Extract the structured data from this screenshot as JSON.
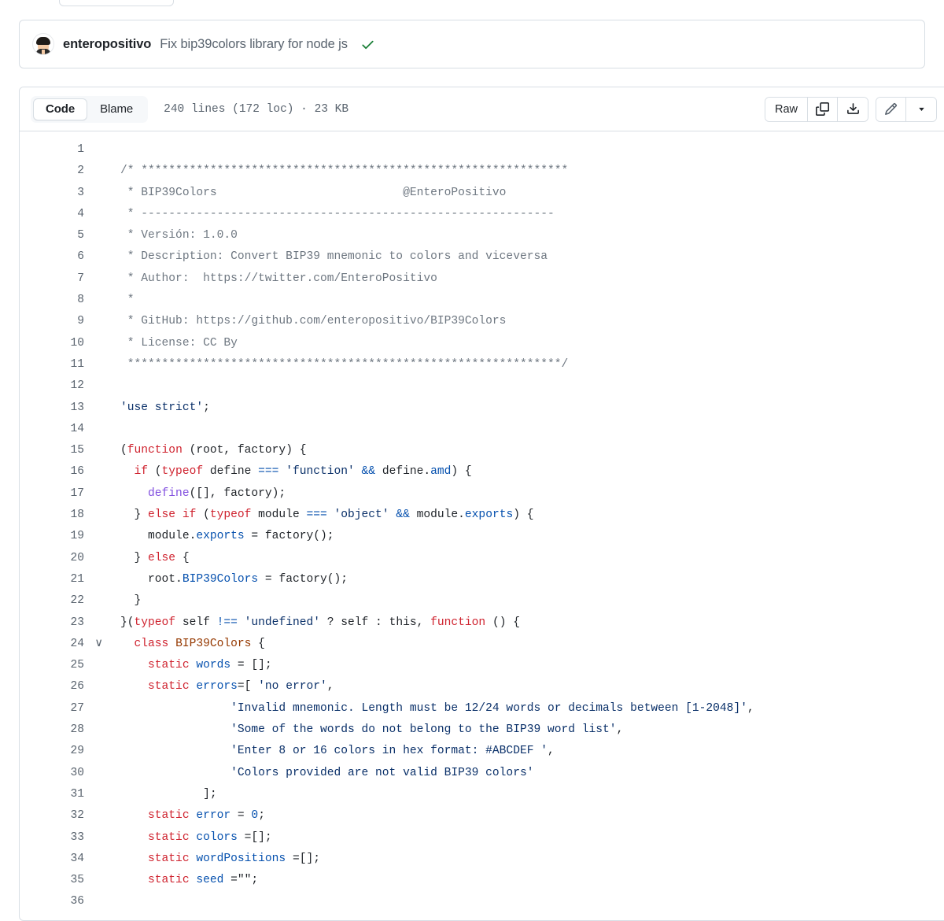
{
  "commit": {
    "author": "enteropositivo",
    "message": "Fix bip39colors library for node js",
    "status_icon": "check-icon",
    "status_color": "#1a7f37"
  },
  "file_header": {
    "tabs": [
      {
        "label": "Code",
        "active": true
      },
      {
        "label": "Blame",
        "active": false
      }
    ],
    "meta": "240 lines (172 loc) · 23 KB",
    "lines_count": "240",
    "loc_count": "172",
    "file_size": "23 KB",
    "actions": {
      "raw_label": "Raw",
      "copy_icon": "copy-icon",
      "download_icon": "download-icon",
      "edit_icon": "pencil-icon",
      "more_icon": "chevron-down-icon"
    }
  },
  "code": {
    "first_line": 1,
    "collapsible_lines": [
      24
    ],
    "lines": [
      {
        "n": 1,
        "tokens": []
      },
      {
        "n": 2,
        "tokens": [
          {
            "t": "c",
            "v": "/* **************************************************************"
          }
        ]
      },
      {
        "n": 3,
        "tokens": [
          {
            "t": "c",
            "v": " * BIP39Colors                           @EnteroPositivo"
          }
        ]
      },
      {
        "n": 4,
        "tokens": [
          {
            "t": "c",
            "v": " * ------------------------------------------------------------"
          }
        ]
      },
      {
        "n": 5,
        "tokens": [
          {
            "t": "c",
            "v": " * Versión: 1.0.0"
          }
        ]
      },
      {
        "n": 6,
        "tokens": [
          {
            "t": "c",
            "v": " * Description: Convert BIP39 mnemonic to colors and viceversa"
          }
        ]
      },
      {
        "n": 7,
        "tokens": [
          {
            "t": "c",
            "v": " * Author:  https://twitter.com/EnteroPositivo"
          }
        ]
      },
      {
        "n": 8,
        "tokens": [
          {
            "t": "c",
            "v": " *"
          }
        ]
      },
      {
        "n": 9,
        "tokens": [
          {
            "t": "c",
            "v": " * GitHub: https://github.com/enteropositivo/BIP39Colors"
          }
        ]
      },
      {
        "n": 10,
        "tokens": [
          {
            "t": "c",
            "v": " * License: CC By"
          }
        ]
      },
      {
        "n": 11,
        "tokens": [
          {
            "t": "c",
            "v": " ***************************************************************/"
          }
        ]
      },
      {
        "n": 12,
        "tokens": []
      },
      {
        "n": 13,
        "tokens": [
          {
            "t": "s",
            "v": "'use strict'"
          },
          {
            "t": "x",
            "v": ";"
          }
        ]
      },
      {
        "n": 14,
        "tokens": []
      },
      {
        "n": 15,
        "tokens": [
          {
            "t": "x",
            "v": "("
          },
          {
            "t": "k",
            "v": "function"
          },
          {
            "t": "x",
            "v": " (root, factory) {"
          }
        ]
      },
      {
        "n": 16,
        "tokens": [
          {
            "t": "x",
            "v": "  "
          },
          {
            "t": "k",
            "v": "if"
          },
          {
            "t": "x",
            "v": " ("
          },
          {
            "t": "k",
            "v": "typeof"
          },
          {
            "t": "x",
            "v": " define "
          },
          {
            "t": "o",
            "v": "==="
          },
          {
            "t": "x",
            "v": " "
          },
          {
            "t": "s",
            "v": "'function'"
          },
          {
            "t": "x",
            "v": " "
          },
          {
            "t": "o",
            "v": "&&"
          },
          {
            "t": "x",
            "v": " define."
          },
          {
            "t": "p",
            "v": "amd"
          },
          {
            "t": "x",
            "v": ") {"
          }
        ]
      },
      {
        "n": 17,
        "tokens": [
          {
            "t": "x",
            "v": "    "
          },
          {
            "t": "f",
            "v": "define"
          },
          {
            "t": "x",
            "v": "([], factory);"
          }
        ]
      },
      {
        "n": 18,
        "tokens": [
          {
            "t": "x",
            "v": "  } "
          },
          {
            "t": "k",
            "v": "else if"
          },
          {
            "t": "x",
            "v": " ("
          },
          {
            "t": "k",
            "v": "typeof"
          },
          {
            "t": "x",
            "v": " module "
          },
          {
            "t": "o",
            "v": "==="
          },
          {
            "t": "x",
            "v": " "
          },
          {
            "t": "s",
            "v": "'object'"
          },
          {
            "t": "x",
            "v": " "
          },
          {
            "t": "o",
            "v": "&&"
          },
          {
            "t": "x",
            "v": " module."
          },
          {
            "t": "p",
            "v": "exports"
          },
          {
            "t": "x",
            "v": ") {"
          }
        ]
      },
      {
        "n": 19,
        "tokens": [
          {
            "t": "x",
            "v": "    module."
          },
          {
            "t": "p",
            "v": "exports"
          },
          {
            "t": "x",
            "v": " = factory();"
          }
        ]
      },
      {
        "n": 20,
        "tokens": [
          {
            "t": "x",
            "v": "  } "
          },
          {
            "t": "k",
            "v": "else"
          },
          {
            "t": "x",
            "v": " {"
          }
        ]
      },
      {
        "n": 21,
        "tokens": [
          {
            "t": "x",
            "v": "    root."
          },
          {
            "t": "p",
            "v": "BIP39Colors"
          },
          {
            "t": "x",
            "v": " = factory();"
          }
        ]
      },
      {
        "n": 22,
        "tokens": [
          {
            "t": "x",
            "v": "  }"
          }
        ]
      },
      {
        "n": 23,
        "tokens": [
          {
            "t": "x",
            "v": "}("
          },
          {
            "t": "k",
            "v": "typeof"
          },
          {
            "t": "x",
            "v": " self "
          },
          {
            "t": "o",
            "v": "!=="
          },
          {
            "t": "x",
            "v": " "
          },
          {
            "t": "s",
            "v": "'undefined'"
          },
          {
            "t": "x",
            "v": " ? self : this, "
          },
          {
            "t": "k",
            "v": "function"
          },
          {
            "t": "x",
            "v": " () {"
          }
        ]
      },
      {
        "n": 24,
        "tokens": [
          {
            "t": "x",
            "v": "  "
          },
          {
            "t": "k",
            "v": "class"
          },
          {
            "t": "x",
            "v": " "
          },
          {
            "t": "t",
            "v": "BIP39Colors"
          },
          {
            "t": "x",
            "v": " {"
          }
        ]
      },
      {
        "n": 25,
        "tokens": [
          {
            "t": "x",
            "v": "    "
          },
          {
            "t": "k",
            "v": "static"
          },
          {
            "t": "x",
            "v": " "
          },
          {
            "t": "p",
            "v": "words"
          },
          {
            "t": "x",
            "v": " = [];"
          }
        ]
      },
      {
        "n": 26,
        "tokens": [
          {
            "t": "x",
            "v": "    "
          },
          {
            "t": "k",
            "v": "static"
          },
          {
            "t": "x",
            "v": " "
          },
          {
            "t": "p",
            "v": "errors"
          },
          {
            "t": "x",
            "v": "=[ "
          },
          {
            "t": "s",
            "v": "'no error'"
          },
          {
            "t": "x",
            "v": ","
          }
        ]
      },
      {
        "n": 27,
        "tokens": [
          {
            "t": "x",
            "v": "                "
          },
          {
            "t": "s",
            "v": "'Invalid mnemonic. Length must be 12/24 words or decimals between [1-2048]'"
          },
          {
            "t": "x",
            "v": ","
          }
        ]
      },
      {
        "n": 28,
        "tokens": [
          {
            "t": "x",
            "v": "                "
          },
          {
            "t": "s",
            "v": "'Some of the words do not belong to the BIP39 word list'"
          },
          {
            "t": "x",
            "v": ","
          }
        ]
      },
      {
        "n": 29,
        "tokens": [
          {
            "t": "x",
            "v": "                "
          },
          {
            "t": "s",
            "v": "'Enter 8 or 16 colors in hex format: #ABCDEF '"
          },
          {
            "t": "x",
            "v": ","
          }
        ]
      },
      {
        "n": 30,
        "tokens": [
          {
            "t": "x",
            "v": "                "
          },
          {
            "t": "s",
            "v": "'Colors provided are not valid BIP39 colors'"
          }
        ]
      },
      {
        "n": 31,
        "tokens": [
          {
            "t": "x",
            "v": "            ];"
          }
        ]
      },
      {
        "n": 32,
        "tokens": [
          {
            "t": "x",
            "v": "    "
          },
          {
            "t": "k",
            "v": "static"
          },
          {
            "t": "x",
            "v": " "
          },
          {
            "t": "p",
            "v": "error"
          },
          {
            "t": "x",
            "v": " = "
          },
          {
            "t": "n",
            "v": "0"
          },
          {
            "t": "x",
            "v": ";"
          }
        ]
      },
      {
        "n": 33,
        "tokens": [
          {
            "t": "x",
            "v": "    "
          },
          {
            "t": "k",
            "v": "static"
          },
          {
            "t": "x",
            "v": " "
          },
          {
            "t": "p",
            "v": "colors"
          },
          {
            "t": "x",
            "v": " =[];"
          }
        ]
      },
      {
        "n": 34,
        "tokens": [
          {
            "t": "x",
            "v": "    "
          },
          {
            "t": "k",
            "v": "static"
          },
          {
            "t": "x",
            "v": " "
          },
          {
            "t": "p",
            "v": "wordPositions"
          },
          {
            "t": "x",
            "v": " =[];"
          }
        ]
      },
      {
        "n": 35,
        "tokens": [
          {
            "t": "x",
            "v": "    "
          },
          {
            "t": "k",
            "v": "static"
          },
          {
            "t": "x",
            "v": " "
          },
          {
            "t": "p",
            "v": "seed"
          },
          {
            "t": "x",
            "v": " =\"\";"
          }
        ]
      },
      {
        "n": 36,
        "tokens": []
      }
    ]
  },
  "colors": {
    "border": "#d8dee4",
    "text": "#1f2328",
    "muted": "#59636e",
    "comment": "#6e7781",
    "keyword": "#cf222e",
    "string": "#0a3069",
    "operator": "#0550ae",
    "type": "#953800",
    "function": "#8250df",
    "success": "#1a7f37",
    "subtle_bg": "#f6f8fa"
  }
}
